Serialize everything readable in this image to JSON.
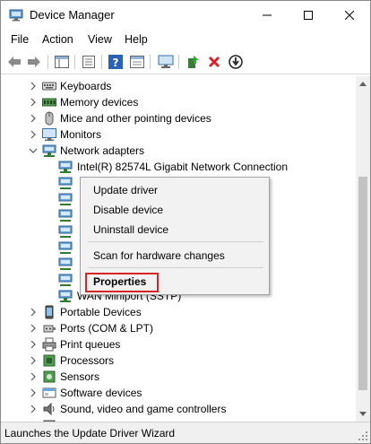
{
  "window": {
    "title": "Device Manager"
  },
  "menu": [
    "File",
    "Action",
    "View",
    "Help"
  ],
  "toolbar": {
    "icons": [
      "back-icon",
      "forward-icon",
      "console-tree-icon",
      "properties-icon",
      "help-icon",
      "details-icon",
      "monitor-icon",
      "update-driver-icon",
      "uninstall-icon",
      "download-icon"
    ]
  },
  "tree": {
    "items": [
      {
        "label": "Keyboards",
        "icon": "keyboard-icon"
      },
      {
        "label": "Memory devices",
        "icon": "memory-icon"
      },
      {
        "label": "Mice and other pointing devices",
        "icon": "mouse-icon"
      },
      {
        "label": "Monitors",
        "icon": "monitor-icon"
      },
      {
        "label": "Network adapters",
        "icon": "network-adapter-icon",
        "expanded": true
      },
      {
        "label": "Intel(R) 82574L Gigabit Network Connection",
        "icon": "network-adapter-icon",
        "child": true
      },
      {
        "label": "WAN Miniport (SSTP)",
        "icon": "network-adapter-icon",
        "child": true
      },
      {
        "label": "Portable Devices",
        "icon": "portable-device-icon"
      },
      {
        "label": "Ports (COM & LPT)",
        "icon": "port-icon"
      },
      {
        "label": "Print queues",
        "icon": "printer-icon"
      },
      {
        "label": "Processors",
        "icon": "processor-icon"
      },
      {
        "label": "Sensors",
        "icon": "sensor-icon"
      },
      {
        "label": "Software devices",
        "icon": "software-device-icon"
      },
      {
        "label": "Sound, video and game controllers",
        "icon": "sound-icon"
      }
    ]
  },
  "context_menu": {
    "items": [
      "Update driver",
      "Disable device",
      "Uninstall device",
      "Scan for hardware changes",
      "Properties"
    ],
    "highlight_color": "#d8232a"
  },
  "status": {
    "text": "Launches the Update Driver Wizard"
  }
}
